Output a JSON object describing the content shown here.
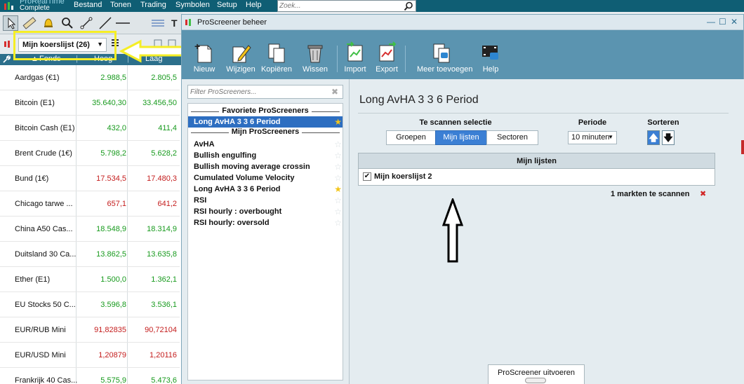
{
  "app": {
    "logo_line1": "ProRealTime",
    "logo_line2": "Complete"
  },
  "menu": {
    "items": [
      "Bestand",
      "Tonen",
      "Trading",
      "Symbolen",
      "Setup",
      "Help"
    ],
    "search_placeholder": "Zoek..."
  },
  "watchlist": {
    "selector_label": "Mijn koerslijst (26)",
    "columns": [
      "Fonds",
      "Hoog",
      "Laag"
    ],
    "rows": [
      {
        "name": "Aardgas (€1)",
        "high": "2.988,5",
        "low": "2.805,5",
        "dir": "up"
      },
      {
        "name": "Bitcoin (E1)",
        "high": "35.640,30",
        "low": "33.456,50",
        "dir": "up"
      },
      {
        "name": "Bitcoin Cash (E1)",
        "high": "432,0",
        "low": "411,4",
        "dir": "up"
      },
      {
        "name": "Brent Crude (1€)",
        "high": "5.798,2",
        "low": "5.628,2",
        "dir": "up"
      },
      {
        "name": "Bund (1€)",
        "high": "17.534,5",
        "low": "17.480,3",
        "dir": "down"
      },
      {
        "name": "Chicago tarwe ...",
        "high": "657,1",
        "low": "641,2",
        "dir": "down"
      },
      {
        "name": "China A50 Cas...",
        "high": "18.548,9",
        "low": "18.314,9",
        "dir": "up"
      },
      {
        "name": "Duitsland 30 Ca...",
        "high": "13.862,5",
        "low": "13.635,8",
        "dir": "up"
      },
      {
        "name": "Ether (E1)",
        "high": "1.500,0",
        "low": "1.362,1",
        "dir": "up"
      },
      {
        "name": "EU Stocks 50 C...",
        "high": "3.596,8",
        "low": "3.536,1",
        "dir": "up"
      },
      {
        "name": "EUR/RUB Mini",
        "high": "91,82835",
        "low": "90,72104",
        "dir": "down"
      },
      {
        "name": "EUR/USD Mini",
        "high": "1,20879",
        "low": "1,20116",
        "dir": "down"
      },
      {
        "name": "Frankrijk 40 Cas...",
        "high": "5.575,9",
        "low": "5.473,6",
        "dir": "up"
      }
    ]
  },
  "dialog": {
    "title": "ProScreener beheer",
    "toolbar": [
      "Nieuw",
      "Wijzigen",
      "Kopiëren",
      "Wissen",
      "Import",
      "Export",
      "Meer toevoegen",
      "Help"
    ],
    "filter_placeholder": "Filter ProScreeners...",
    "favorites_header": "Favoriete ProScreeners",
    "favorites": [
      "Long AvHA 3 3 6 Period"
    ],
    "mine_header": "Mijn ProScreeners",
    "mine": [
      {
        "name": "AvHA",
        "fav": false
      },
      {
        "name": "Bullish engulfing",
        "fav": false
      },
      {
        "name": "Bullish moving average crossin",
        "fav": false
      },
      {
        "name": "Cumulated Volume  Velocity",
        "fav": false
      },
      {
        "name": "Long AvHA 3 3 6 Period",
        "fav": true
      },
      {
        "name": "RSI",
        "fav": false
      },
      {
        "name": "RSI hourly : overbought",
        "fav": false
      },
      {
        "name": "RSI hourly: oversold",
        "fav": false
      }
    ],
    "screener_title": "Long AvHA 3 3 6 Period",
    "scan_selection_label": "Te scannen selectie",
    "scan_tabs": [
      "Groepen",
      "Mijn lijsten",
      "Sectoren"
    ],
    "period_label": "Periode",
    "period_value": "10 minuten",
    "sort_label": "Sorteren",
    "lists_header": "Mijn lijsten",
    "list_item": "Mijn koerslijst 2",
    "markets_count": "1 markten te scannen",
    "run_button": "ProScreener uitvoeren"
  },
  "colors": {
    "menubar": "#0f5e74",
    "toolbar": "#5b94b0",
    "selected": "#2d6ec1",
    "highlight": "#f5ee25",
    "up": "#179a1d",
    "down": "#c41d1d"
  }
}
